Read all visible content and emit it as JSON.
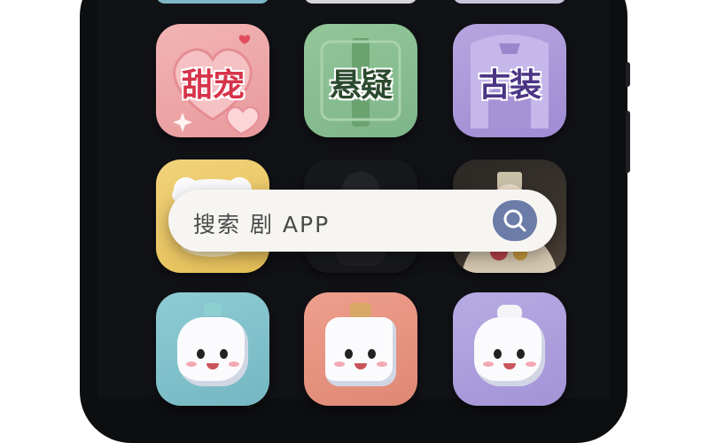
{
  "search": {
    "text": "搜索 剧  APP"
  },
  "apps": {
    "tianchong": {
      "label": "甜宠"
    },
    "xuanyi": {
      "label": "悬疑"
    },
    "guzhuang": {
      "label": "古装"
    }
  },
  "colors": {
    "phone_frame": "#0d0e10",
    "screen_bg": "#111216",
    "search_bar": "#f7f5f2",
    "search_button": "#6b7ca8"
  },
  "icons": [
    "heart-icon",
    "sparkle-icon",
    "search-icon",
    "mascot-icon"
  ]
}
